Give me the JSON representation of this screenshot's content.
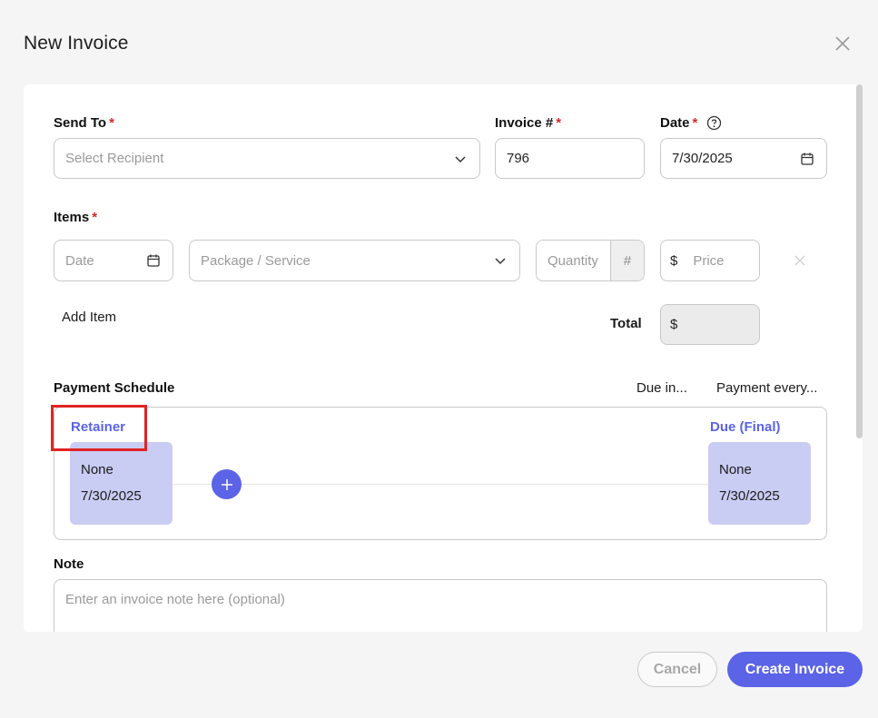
{
  "modal": {
    "title": "New Invoice"
  },
  "send_to": {
    "label": "Send To",
    "required": "*",
    "placeholder": "Select Recipient"
  },
  "invoice_number": {
    "label": "Invoice #",
    "required": "*",
    "value": "796"
  },
  "date": {
    "label": "Date",
    "required": "*",
    "value": "7/30/2025"
  },
  "items": {
    "label": "Items",
    "required": "*",
    "row": {
      "date_placeholder": "Date",
      "service_placeholder": "Package / Service",
      "quantity_placeholder": "Quantity",
      "quantity_suffix": "#",
      "price_prefix": "$",
      "price_placeholder": "Price"
    },
    "add_item_label": "Add Item",
    "total_label": "Total",
    "total_prefix": "$"
  },
  "payment_schedule": {
    "label": "Payment Schedule",
    "due_in_label": "Due in...",
    "payment_every_label": "Payment every...",
    "retainer": {
      "label": "Retainer",
      "amount": "None",
      "date": "7/30/2025"
    },
    "final": {
      "label": "Due (Final)",
      "amount": "None",
      "date": "7/30/2025"
    }
  },
  "note": {
    "label": "Note",
    "placeholder": "Enter an invoice note here (optional)"
  },
  "footer": {
    "cancel_label": "Cancel",
    "create_label": "Create Invoice"
  },
  "colors": {
    "accent": "#5b63e6",
    "tile": "#c9ccf3",
    "required": "#d62828",
    "highlight": "#e02424"
  }
}
